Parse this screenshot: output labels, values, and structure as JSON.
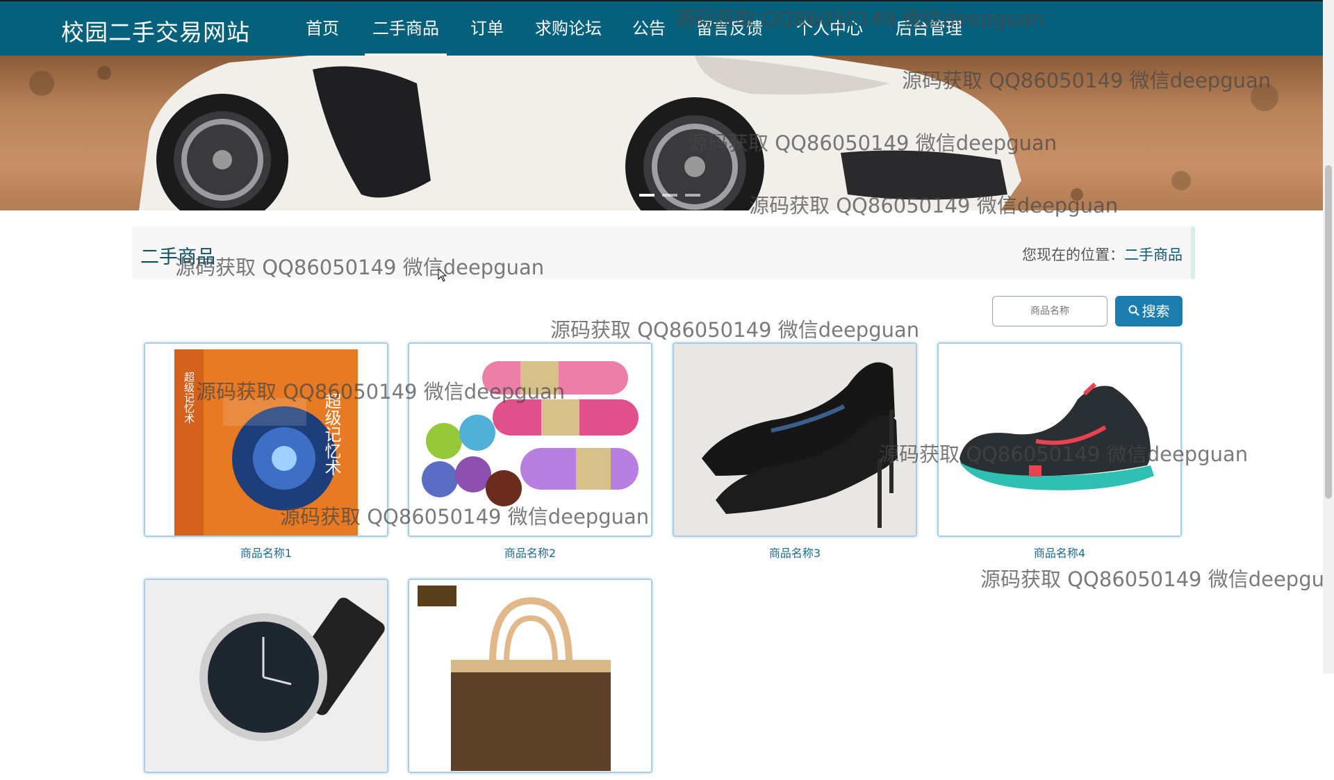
{
  "site": {
    "title": "校园二手交易网站"
  },
  "nav": {
    "items": [
      {
        "label": "首页"
      },
      {
        "label": "二手商品",
        "active": true
      },
      {
        "label": "订单"
      },
      {
        "label": "求购论坛"
      },
      {
        "label": "公告"
      },
      {
        "label": "留言反馈"
      },
      {
        "label": "个人中心"
      },
      {
        "label": "后台管理"
      }
    ]
  },
  "page": {
    "section_title": "二手商品",
    "location_label": "您现在的位置：",
    "location_current": "二手商品"
  },
  "search": {
    "placeholder": "商品名称",
    "button_label": "搜索",
    "button_icon": "search-icon"
  },
  "products": [
    {
      "name": "商品名称1",
      "image": "memory-book"
    },
    {
      "name": "商品名称2",
      "image": "yoga-mats"
    },
    {
      "name": "商品名称3",
      "image": "high-heels"
    },
    {
      "name": "商品名称4",
      "image": "sneaker"
    },
    {
      "name": "",
      "image": "wristwatch"
    },
    {
      "name": "",
      "image": "handbag"
    }
  ],
  "book_cover": {
    "side_text": "超级记忆术",
    "front_text": "超级记忆术"
  },
  "watermark": {
    "text": "源码获取 QQ86050149 微信deepguan"
  },
  "colors": {
    "header": "#05607c",
    "accent": "#1c7db1",
    "link": "#1b6a8e"
  }
}
